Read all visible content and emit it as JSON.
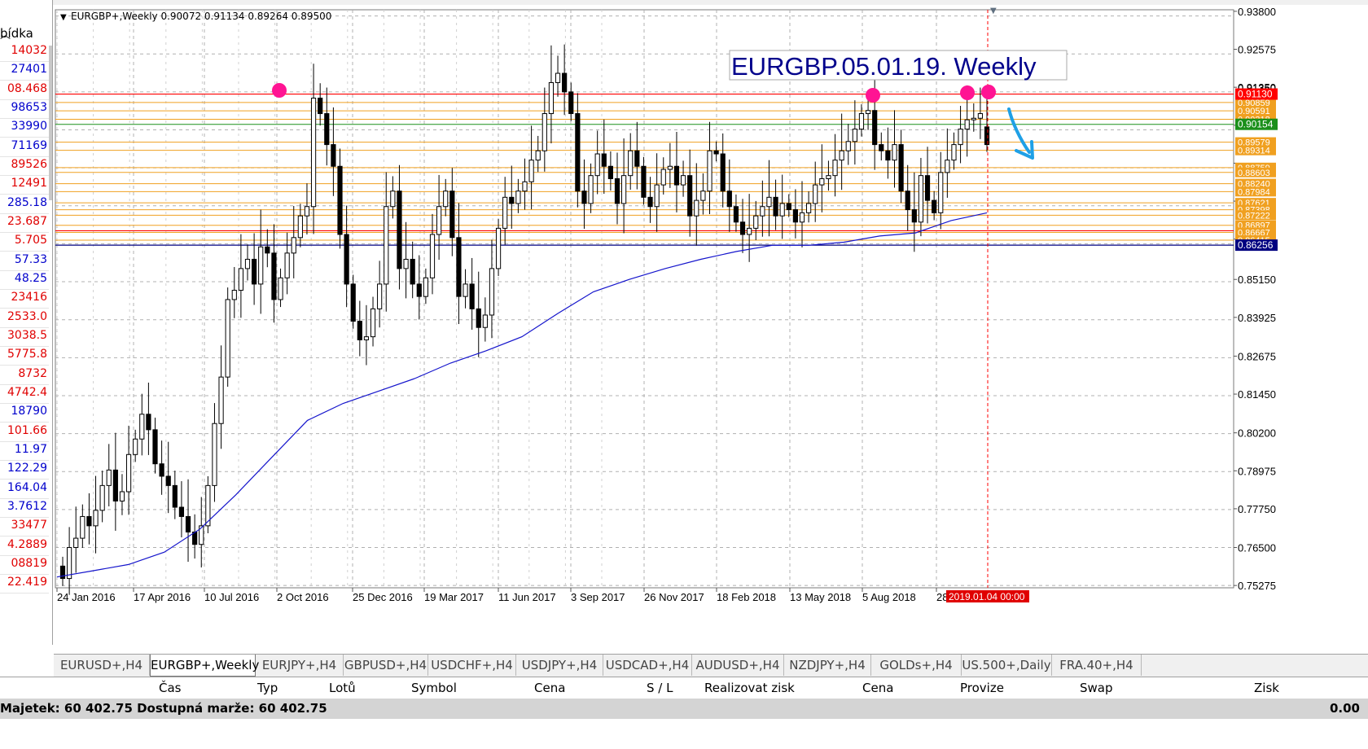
{
  "symbol_info": "EURGBP+,Weekly  0.90072 0.91134 0.89264 0.89500",
  "annotation_text": "EURGBP.05.01.19. Weekly",
  "price_levels": {
    "red_resistance": "0.91130",
    "green_current": "0.90154",
    "blue_support": "0.86256",
    "orange": [
      "0.90859",
      "0.90591",
      "0.90318",
      "0.89579",
      "0.89314",
      "0.88759",
      "0.88603",
      "0.88240",
      "0.87984",
      "0.87621",
      "0.87398",
      "0.87222",
      "0.86897",
      "0.86667",
      "0.86415"
    ]
  },
  "price_axis": [
    "0.93800",
    "0.92575",
    "0.91350",
    "0.90125",
    "0.88900",
    "0.87675",
    "0.86450",
    "0.85150",
    "0.83925",
    "0.82675",
    "0.81450",
    "0.80200",
    "0.78975",
    "0.77750",
    "0.76500",
    "0.75275"
  ],
  "time_axis": [
    "24 Jan 2016",
    "17 Apr 2016",
    "10 Jul 2016",
    "2 Oct 2016",
    "25 Dec 2016",
    "19 Mar 2017",
    "11 Jun 2017",
    "3 Sep 2017",
    "26 Nov 2017",
    "18 Feb 2018",
    "13 May 2018",
    "5 Aug 2018",
    "28"
  ],
  "cursor_time": "2019.01.04 00:00",
  "left_panel": {
    "header": "bídka",
    "values": [
      "14032",
      "27401",
      "08.468",
      "98653",
      "33990",
      "71169",
      "89526",
      "12491",
      "285.18",
      "23.687",
      "5.705",
      "57.33",
      "48.25",
      "23416",
      "2533.0",
      "3038.5",
      "5775.8",
      "8732",
      "4742.4",
      "18790",
      "101.66",
      "11.97",
      "122.29",
      "164.04",
      "3.7612",
      "33477",
      "4.2889",
      "08819",
      "22.419"
    ],
    "value_colors": [
      "red",
      "blue",
      "red",
      "blue",
      "blue",
      "blue",
      "red",
      "red",
      "blue",
      "red",
      "red",
      "blue",
      "blue",
      "red",
      "red",
      "red",
      "red",
      "red",
      "red",
      "blue",
      "red",
      "blue",
      "blue",
      "blue",
      "blue",
      "red",
      "red",
      "red",
      "red"
    ]
  },
  "tabs": [
    "EURUSD+,H4",
    "EURGBP+,Weekly",
    "EURJPY+,H4",
    "GBPUSD+,H4",
    "USDCHF+,H4",
    "USDJPY+,H4",
    "USDCAD+,H4",
    "AUDUSD+,H4",
    "NZDJPY+,H4",
    "GOLDs+,H4",
    "US.500+,Daily",
    "FRA.40+,H4"
  ],
  "active_tab": "EURGBP+,Weekly",
  "columns": [
    "Čas",
    "Typ",
    "Lotů",
    "Symbol",
    "Cena",
    "S / L",
    "Realizovat zisk",
    "Cena",
    "Provize",
    "Swap",
    "Zisk"
  ],
  "status_text": "Majetek: 60 402.75  Dostupná marže: 60 402.75",
  "status_profit": "0.00",
  "colors": {
    "candle": "#000000",
    "ma": "#1515cc",
    "orange": "#f0a020",
    "red": "#ff0000",
    "grid": "#b0b0b0",
    "marker": "#ff1493",
    "arrow": "#1fa0e6"
  },
  "chart_data": {
    "type": "candlestick",
    "symbol": "EURGBP+",
    "timeframe": "Weekly",
    "ylim": [
      0.752,
      0.9385
    ],
    "start_date": "2016-01-17",
    "current_bar": {
      "open": 0.90072,
      "high": 0.91134,
      "low": 0.89264,
      "close": 0.895
    },
    "close_series": [
      0.755,
      0.765,
      0.768,
      0.775,
      0.772,
      0.777,
      0.785,
      0.79,
      0.78,
      0.783,
      0.795,
      0.8,
      0.808,
      0.803,
      0.792,
      0.788,
      0.785,
      0.778,
      0.775,
      0.77,
      0.766,
      0.772,
      0.785,
      0.805,
      0.82,
      0.845,
      0.848,
      0.855,
      0.858,
      0.85,
      0.862,
      0.86,
      0.845,
      0.852,
      0.86,
      0.865,
      0.872,
      0.875,
      0.91,
      0.905,
      0.895,
      0.888,
      0.866,
      0.85,
      0.838,
      0.832,
      0.833,
      0.842,
      0.85,
      0.875,
      0.88,
      0.855,
      0.858,
      0.85,
      0.846,
      0.852,
      0.866,
      0.875,
      0.88,
      0.865,
      0.846,
      0.85,
      0.842,
      0.836,
      0.84,
      0.855,
      0.868,
      0.878,
      0.876,
      0.88,
      0.883,
      0.89,
      0.893,
      0.905,
      0.915,
      0.918,
      0.912,
      0.905,
      0.88,
      0.876,
      0.885,
      0.892,
      0.888,
      0.884,
      0.876,
      0.885,
      0.893,
      0.888,
      0.878,
      0.875,
      0.882,
      0.887,
      0.888,
      0.882,
      0.885,
      0.872,
      0.877,
      0.88,
      0.893,
      0.892,
      0.88,
      0.875,
      0.87,
      0.866,
      0.868,
      0.872,
      0.875,
      0.878,
      0.872,
      0.876,
      0.874,
      0.87,
      0.873,
      0.876,
      0.882,
      0.884,
      0.885,
      0.89,
      0.893,
      0.896,
      0.9,
      0.905,
      0.906,
      0.895,
      0.893,
      0.89,
      0.895,
      0.88,
      0.874,
      0.87,
      0.885,
      0.877,
      0.873,
      0.886,
      0.89,
      0.895,
      0.9,
      0.903,
      0.9035,
      0.905,
      0.895
    ],
    "ma_series": [
      0.7555,
      0.7575,
      0.7595,
      0.7635,
      0.771,
      0.782,
      0.794,
      0.806,
      0.8115,
      0.8155,
      0.8195,
      0.8245,
      0.8285,
      0.833,
      0.8405,
      0.8475,
      0.8515,
      0.855,
      0.858,
      0.8605,
      0.8625,
      0.8625,
      0.8635,
      0.8655,
      0.8665,
      0.8705,
      0.873
    ]
  }
}
